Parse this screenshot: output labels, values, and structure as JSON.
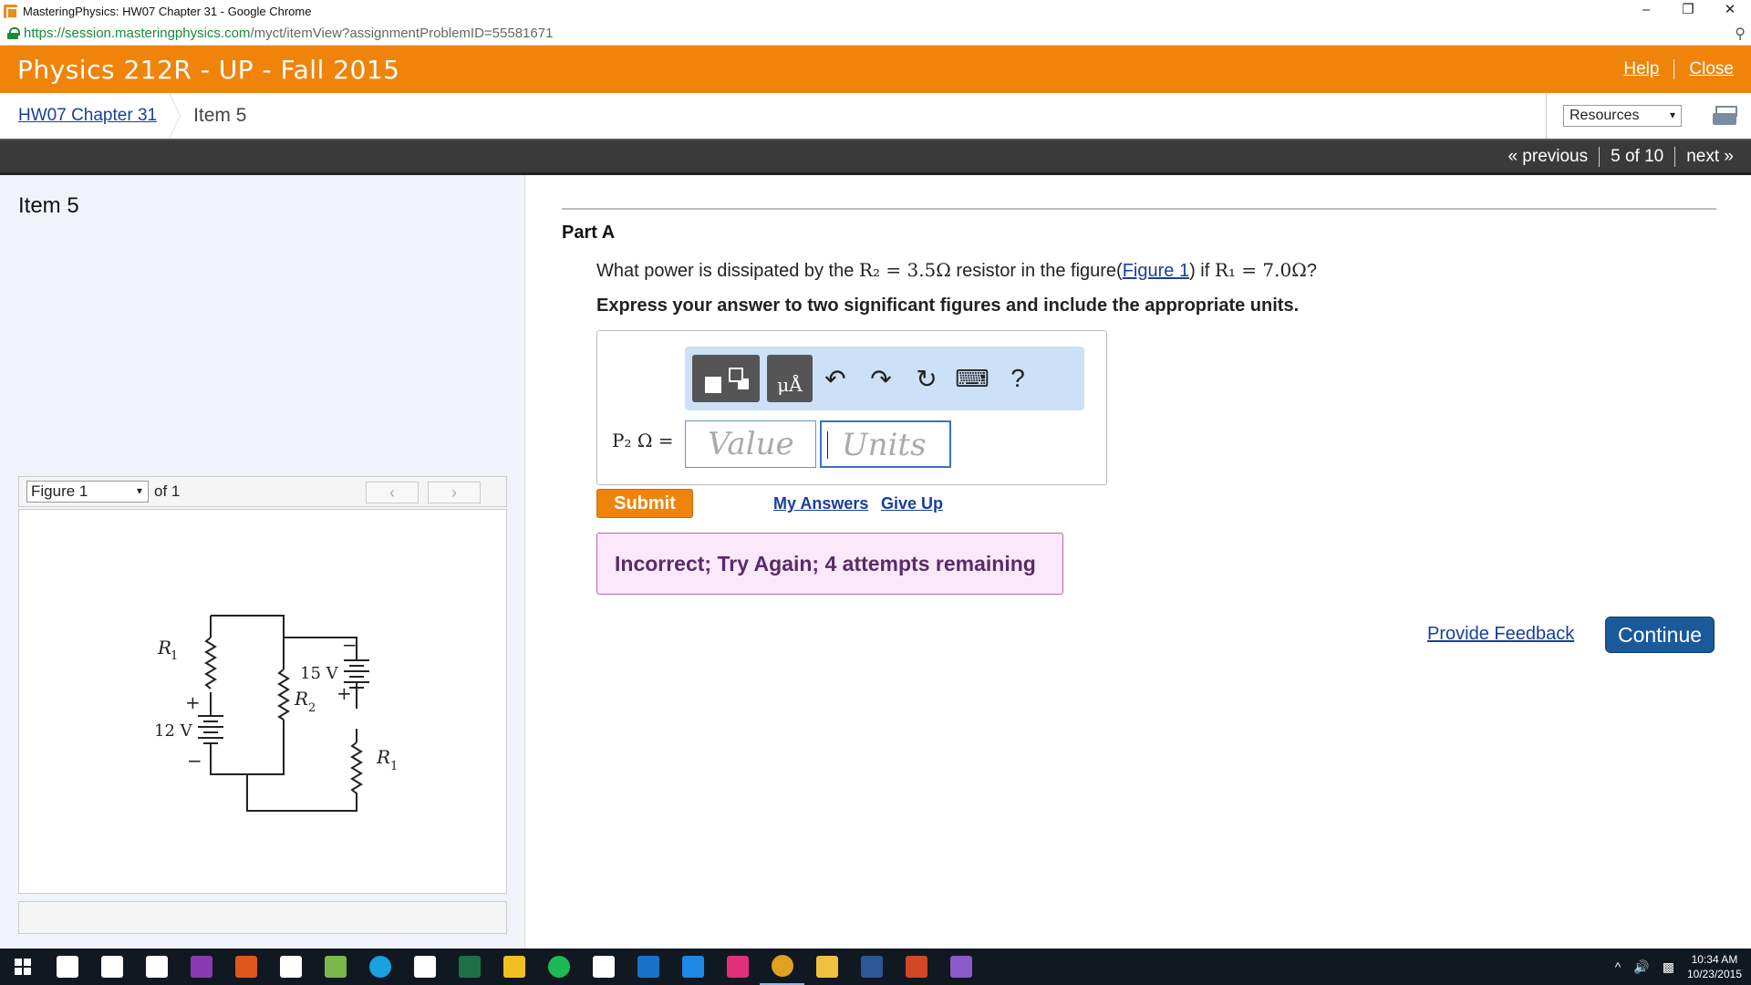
{
  "browser": {
    "window_title": "MasteringPhysics: HW07 Chapter 31 - Google Chrome",
    "url_host": "https://session.masteringphysics.com",
    "url_path": "/myct/itemView?assignmentProblemID=55581671"
  },
  "header": {
    "course": "Physics 212R - UP - Fall 2015",
    "help": "Help",
    "close": "Close"
  },
  "breadcrumb": {
    "assignment": "HW07 Chapter 31",
    "current": "Item 5",
    "resources": "Resources"
  },
  "nav": {
    "previous": "« previous",
    "position": "5 of 10",
    "next": "next »"
  },
  "left": {
    "item_title": "Item 5",
    "figure_select": "Figure 1",
    "figure_of": "of 1",
    "prev_btn": "‹",
    "next_btn": "›",
    "circuit": {
      "r1_top": "R",
      "r1_sub": "1",
      "v12": "12 V",
      "v15": "15 V",
      "r2": "R",
      "r2_sub": "2",
      "r1b": "R",
      "r1b_sub": "1",
      "plus": "+",
      "minus": "−"
    }
  },
  "part": {
    "title": "Part A",
    "q_pre": "What power is dissipated by the ",
    "q_math1": "R₂ = 3.5Ω",
    "q_mid": " resistor in the figure(",
    "q_link": "Figure 1",
    "q_post": ") if ",
    "q_math2": "R₁ = 7.0Ω",
    "q_end": "?",
    "instruction": "Express your answer to two significant figures and include the appropriate units.",
    "answer_label": "P₂ Ω =",
    "value_placeholder": "Value",
    "units_placeholder": "Units",
    "units_button": "μÅ",
    "help_symbol": "?",
    "submit": "Submit",
    "my_answers": "My Answers",
    "give_up": "Give Up",
    "feedback": "Incorrect; Try Again; 4 attempts remaining",
    "provide_feedback": "Provide Feedback",
    "continue": "Continue"
  },
  "taskbar": {
    "apps": [
      {
        "name": "task-view",
        "color": "#ffffff"
      },
      {
        "name": "store",
        "color": "#ffffff"
      },
      {
        "name": "microphone",
        "color": "#ffffff"
      },
      {
        "name": "onenote",
        "color": "#8a3ab0"
      },
      {
        "name": "office",
        "color": "#e0561c"
      },
      {
        "name": "calendar",
        "color": "#ffffff"
      },
      {
        "name": "settings",
        "color": "#7ab648"
      },
      {
        "name": "skype",
        "color": "#1aa1e0"
      },
      {
        "name": "calculator",
        "color": "#ffffff"
      },
      {
        "name": "excel",
        "color": "#1e7145"
      },
      {
        "name": "paint",
        "color": "#f0c020"
      },
      {
        "name": "spotify",
        "color": "#1db954"
      },
      {
        "name": "mail",
        "color": "#ffffff"
      },
      {
        "name": "edge",
        "color": "#1a72c8"
      },
      {
        "name": "weather",
        "color": "#1e88e5"
      },
      {
        "name": "groove",
        "color": "#e0307a"
      },
      {
        "name": "chrome",
        "color": "#e0a020"
      },
      {
        "name": "explorer",
        "color": "#f0c040"
      },
      {
        "name": "word",
        "color": "#2b5797"
      },
      {
        "name": "powerpoint",
        "color": "#d24726"
      },
      {
        "name": "visual-studio",
        "color": "#8a5ac8"
      }
    ],
    "time": "10:34 AM",
    "date": "10/23/2015"
  }
}
